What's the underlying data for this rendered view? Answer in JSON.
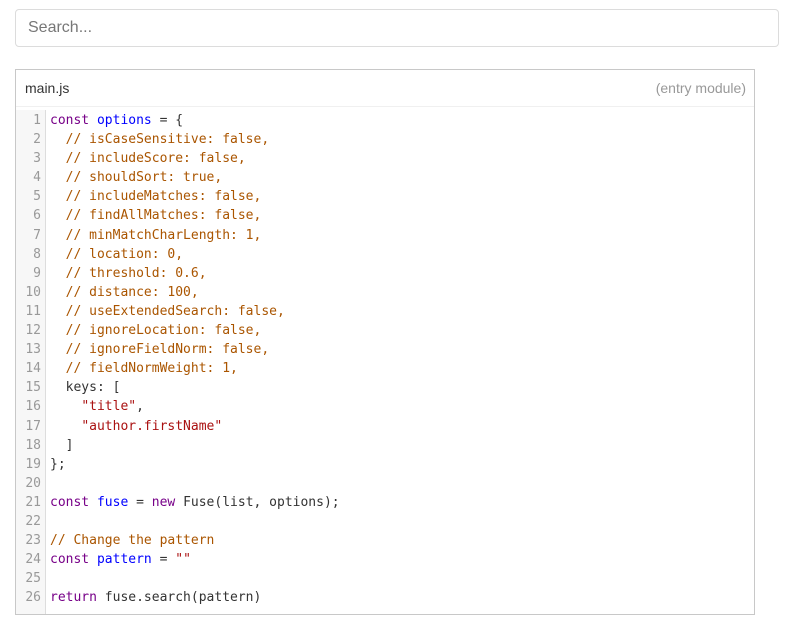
{
  "search": {
    "placeholder": "Search..."
  },
  "editor": {
    "file_name": "main.js",
    "module_tag": "(entry module)",
    "colors": {
      "keyword": "#770088",
      "def": "#0000ff",
      "comment": "#aa5500",
      "string": "#aa1111",
      "plain": "#333333"
    },
    "lines": [
      {
        "no": "1",
        "tokens": [
          {
            "t": "const",
            "c": "keyword"
          },
          {
            "t": " ",
            "c": "plain"
          },
          {
            "t": "options",
            "c": "def"
          },
          {
            "t": " = {",
            "c": "plain"
          }
        ]
      },
      {
        "no": "2",
        "tokens": [
          {
            "t": "  ",
            "c": "plain"
          },
          {
            "t": "// isCaseSensitive: false,",
            "c": "comment"
          }
        ]
      },
      {
        "no": "3",
        "tokens": [
          {
            "t": "  ",
            "c": "plain"
          },
          {
            "t": "// includeScore: false,",
            "c": "comment"
          }
        ]
      },
      {
        "no": "4",
        "tokens": [
          {
            "t": "  ",
            "c": "plain"
          },
          {
            "t": "// shouldSort: true,",
            "c": "comment"
          }
        ]
      },
      {
        "no": "5",
        "tokens": [
          {
            "t": "  ",
            "c": "plain"
          },
          {
            "t": "// includeMatches: false,",
            "c": "comment"
          }
        ]
      },
      {
        "no": "6",
        "tokens": [
          {
            "t": "  ",
            "c": "plain"
          },
          {
            "t": "// findAllMatches: false,",
            "c": "comment"
          }
        ]
      },
      {
        "no": "7",
        "tokens": [
          {
            "t": "  ",
            "c": "plain"
          },
          {
            "t": "// minMatchCharLength: 1,",
            "c": "comment"
          }
        ]
      },
      {
        "no": "8",
        "tokens": [
          {
            "t": "  ",
            "c": "plain"
          },
          {
            "t": "// location: 0,",
            "c": "comment"
          }
        ]
      },
      {
        "no": "9",
        "tokens": [
          {
            "t": "  ",
            "c": "plain"
          },
          {
            "t": "// threshold: 0.6,",
            "c": "comment"
          }
        ]
      },
      {
        "no": "10",
        "tokens": [
          {
            "t": "  ",
            "c": "plain"
          },
          {
            "t": "// distance: 100,",
            "c": "comment"
          }
        ]
      },
      {
        "no": "11",
        "tokens": [
          {
            "t": "  ",
            "c": "plain"
          },
          {
            "t": "// useExtendedSearch: false,",
            "c": "comment"
          }
        ]
      },
      {
        "no": "12",
        "tokens": [
          {
            "t": "  ",
            "c": "plain"
          },
          {
            "t": "// ignoreLocation: false,",
            "c": "comment"
          }
        ]
      },
      {
        "no": "13",
        "tokens": [
          {
            "t": "  ",
            "c": "plain"
          },
          {
            "t": "// ignoreFieldNorm: false,",
            "c": "comment"
          }
        ]
      },
      {
        "no": "14",
        "tokens": [
          {
            "t": "  ",
            "c": "plain"
          },
          {
            "t": "// fieldNormWeight: 1,",
            "c": "comment"
          }
        ]
      },
      {
        "no": "15",
        "tokens": [
          {
            "t": "  keys: [",
            "c": "plain"
          }
        ]
      },
      {
        "no": "16",
        "tokens": [
          {
            "t": "    ",
            "c": "plain"
          },
          {
            "t": "\"title\"",
            "c": "string"
          },
          {
            "t": ",",
            "c": "plain"
          }
        ]
      },
      {
        "no": "17",
        "tokens": [
          {
            "t": "    ",
            "c": "plain"
          },
          {
            "t": "\"author.firstName\"",
            "c": "string"
          }
        ]
      },
      {
        "no": "18",
        "tokens": [
          {
            "t": "  ]",
            "c": "plain"
          }
        ]
      },
      {
        "no": "19",
        "tokens": [
          {
            "t": "};",
            "c": "plain"
          }
        ]
      },
      {
        "no": "20",
        "tokens": []
      },
      {
        "no": "21",
        "tokens": [
          {
            "t": "const",
            "c": "keyword"
          },
          {
            "t": " ",
            "c": "plain"
          },
          {
            "t": "fuse",
            "c": "def"
          },
          {
            "t": " = ",
            "c": "plain"
          },
          {
            "t": "new",
            "c": "keyword"
          },
          {
            "t": " Fuse(list, options);",
            "c": "plain"
          }
        ]
      },
      {
        "no": "22",
        "tokens": []
      },
      {
        "no": "23",
        "tokens": [
          {
            "t": "// Change the pattern",
            "c": "comment"
          }
        ]
      },
      {
        "no": "24",
        "tokens": [
          {
            "t": "const",
            "c": "keyword"
          },
          {
            "t": " ",
            "c": "plain"
          },
          {
            "t": "pattern",
            "c": "def"
          },
          {
            "t": " = ",
            "c": "plain"
          },
          {
            "t": "\"\"",
            "c": "string"
          }
        ]
      },
      {
        "no": "25",
        "tokens": []
      },
      {
        "no": "26",
        "tokens": [
          {
            "t": "return",
            "c": "keyword"
          },
          {
            "t": " fuse.search(pattern)",
            "c": "plain"
          }
        ]
      }
    ]
  }
}
